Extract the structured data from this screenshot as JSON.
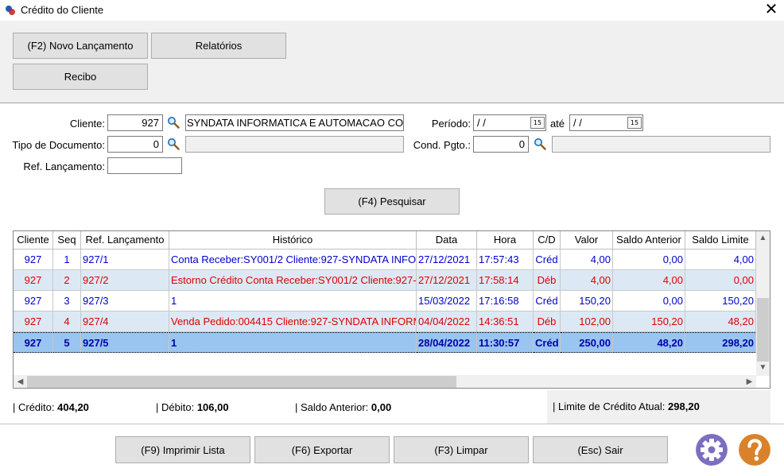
{
  "window": {
    "title": "Crédito do Cliente",
    "close_glyph": "✕"
  },
  "toolbar": {
    "new_entry": "(F2) Novo Lançamento",
    "reports": "Relatórios",
    "receipt": "Recibo"
  },
  "filters": {
    "client_label": "Cliente:",
    "client_code": "927",
    "client_name": "SYNDATA INFORMATICA E AUTOMACAO COM",
    "doc_type_label": "Tipo de Documento:",
    "doc_type_code": "0",
    "doc_type_name": "",
    "ref_label": "Ref. Lançamento:",
    "ref_value": "",
    "period_label": "Período:",
    "period_from": " /  /",
    "until_label": "até",
    "period_to": " /  /",
    "calendar_glyph": "15",
    "payment_label": "Cond. Pgto.:",
    "payment_code": "0",
    "payment_name": "",
    "search_button": "(F4) Pesquisar"
  },
  "grid": {
    "columns": [
      "Cliente",
      "Seq",
      "Ref. Lançamento",
      "Histórico",
      "Data",
      "Hora",
      "C/D",
      "Valor",
      "Saldo Anterior",
      "Saldo Limite"
    ],
    "rows": [
      {
        "cliente": "927",
        "seq": "1",
        "ref": "927/1",
        "historico": "Conta Receber:SY001/2 Cliente:927-SYNDATA INFO",
        "data": "27/12/2021",
        "hora": "17:57:43",
        "cd": "Créd",
        "valor": "4,00",
        "saldo_anterior": "0,00",
        "saldo_limite": "4,00"
      },
      {
        "cliente": "927",
        "seq": "2",
        "ref": "927/2",
        "historico": "Estorno Crédito Conta Receber:SY001/2 Cliente:927-",
        "data": "27/12/2021",
        "hora": "17:58:14",
        "cd": "Déb",
        "valor": "4,00",
        "saldo_anterior": "4,00",
        "saldo_limite": "0,00"
      },
      {
        "cliente": "927",
        "seq": "3",
        "ref": "927/3",
        "historico": "1",
        "data": "15/03/2022",
        "hora": "17:16:58",
        "cd": "Créd",
        "valor": "150,20",
        "saldo_anterior": "0,00",
        "saldo_limite": "150,20"
      },
      {
        "cliente": "927",
        "seq": "4",
        "ref": "927/4",
        "historico": "Venda Pedido:004415 Cliente:927-SYNDATA INFORM",
        "data": "04/04/2022",
        "hora": "14:36:51",
        "cd": "Déb",
        "valor": "102,00",
        "saldo_anterior": "150,20",
        "saldo_limite": "48,20"
      },
      {
        "cliente": "927",
        "seq": "5",
        "ref": "927/5",
        "historico": "1",
        "data": "28/04/2022",
        "hora": "11:30:57",
        "cd": "Créd",
        "valor": "250,00",
        "saldo_anterior": "48,20",
        "saldo_limite": "298,20"
      }
    ]
  },
  "totals": {
    "credit_label": "| Crédito:",
    "credit_value": "404,20",
    "debit_label": "| Débito:",
    "debit_value": "106,00",
    "prev_label": "| Saldo Anterior:",
    "prev_value": "0,00",
    "limit_label": "| Limite de Crédito Atual:",
    "limit_value": "298,20"
  },
  "footer": {
    "print": "(F9) Imprimir Lista",
    "export": "(F6) Exportar",
    "clear": "(F3) Limpar",
    "exit": "(Esc) Sair"
  },
  "icons": {
    "settings": "gear-icon",
    "help": "question-icon",
    "search": "magnifier-icon"
  },
  "colors": {
    "credit_text": "#0000cc",
    "debit_text": "#dd0000",
    "debit_row": "#dce9f5",
    "selected_row": "#99c5f0",
    "gear": "#7b6fbf",
    "help": "#d9822b"
  }
}
